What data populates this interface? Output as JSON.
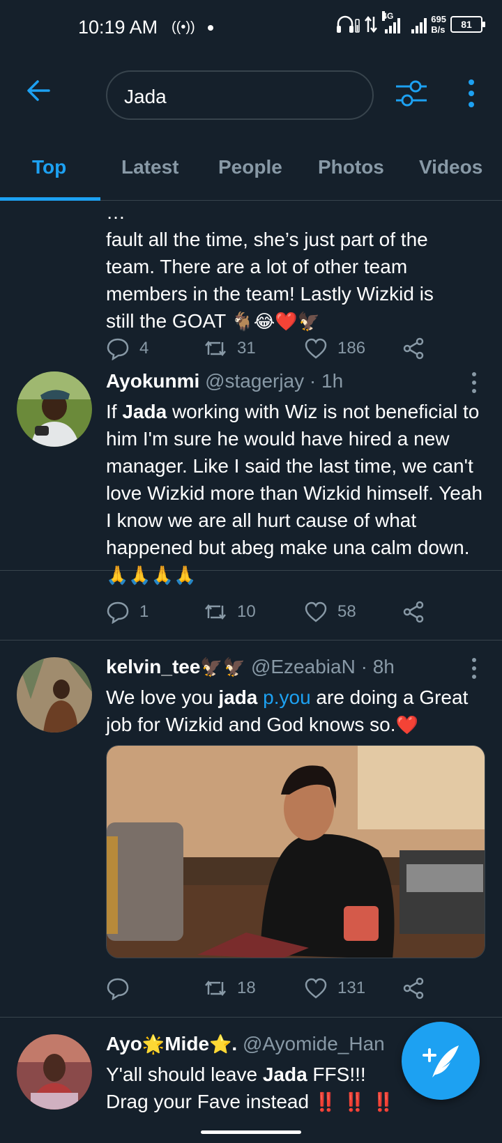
{
  "status": {
    "time": "10:19 AM",
    "network_type": "4G",
    "speed_value": "695",
    "speed_unit": "B/s",
    "battery": "81"
  },
  "search": {
    "value": "Jada"
  },
  "tabs": [
    {
      "label": "Top",
      "active": true
    },
    {
      "label": "Latest",
      "active": false
    },
    {
      "label": "People",
      "active": false
    },
    {
      "label": "Photos",
      "active": false
    },
    {
      "label": "Videos",
      "active": false
    }
  ],
  "tweets": [
    {
      "text_lines": [
        "fault all the time, she’s just part of the",
        "team. There are a lot of other team",
        "members in the team! Lastly Wizkid is",
        "still the GOAT "
      ],
      "emojis": "🐐😂❤️🦅",
      "replies": "4",
      "retweets": "31",
      "likes": "186"
    },
    {
      "name": "Ayokunmi",
      "handle": "@stagerjay",
      "time": "1h",
      "text_prefix": "If ",
      "text_bold": "Jada",
      "text_rest": " working with Wiz is not beneficial to him I'm sure he would have hired a new manager. Like I said the last time, we can't love Wizkid more than Wizkid himself. Yeah I know we are all hurt cause  of what happened but abeg make una calm down.",
      "emojis": "🙏🙏🙏🙏",
      "replies": "1",
      "retweets": "10",
      "likes": "58"
    },
    {
      "name": "kelvin_tee",
      "name_emojis": "🦅🦅",
      "handle": "@EzeabiaN",
      "time": "8h",
      "text_prefix": "We love you ",
      "text_bold": "jada",
      "text_link": "p.you",
      "text_rest": " are doing a Great job for Wizkid and God knows so.",
      "emojis": "❤️",
      "replies": "",
      "retweets": "18",
      "likes": "131"
    },
    {
      "name_part1": "Ayo",
      "name_emoji1": "🌟",
      "name_part2": "Mide",
      "name_emoji2": "⭐",
      "name_part3": ".",
      "handle": "@Ayomide_Han",
      "text_prefix": "Y'all should leave ",
      "text_bold": "Jada",
      "text_rest": " FFS!!!",
      "text_line2": "Drag your Fave instead ",
      "emojis": "‼️ ‼️ ‼️"
    }
  ],
  "colors": {
    "background": "#15202b",
    "accent": "#1da1f2",
    "muted": "#8899a6",
    "divider": "#38444d"
  },
  "icons": [
    "back-arrow-icon",
    "filter-icon",
    "more-vertical-icon",
    "reply-icon",
    "retweet-icon",
    "like-icon",
    "share-icon",
    "compose-tweet-icon"
  ]
}
